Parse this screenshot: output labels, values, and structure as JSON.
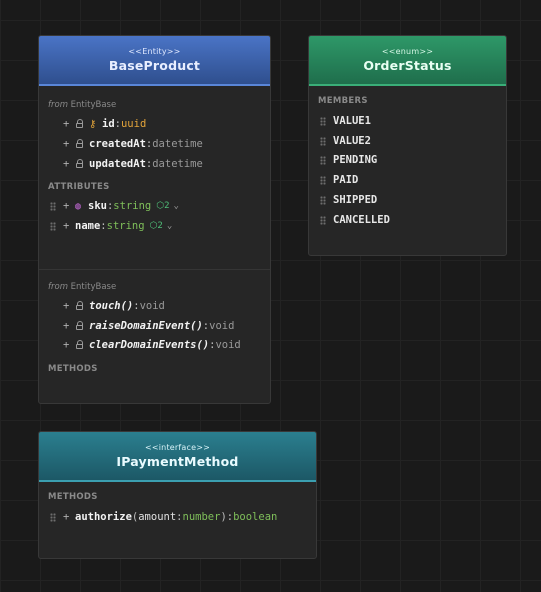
{
  "base_product": {
    "stereotype": "<<Entity>>",
    "name": "BaseProduct",
    "inherited_from_label": "from",
    "inherited_from": "EntityBase",
    "inherited_attributes": [
      {
        "vis": "+",
        "name": "id",
        "type": "uuid",
        "key": true
      },
      {
        "vis": "+",
        "name": "createdAt",
        "type": "datetime"
      },
      {
        "vis": "+",
        "name": "updatedAt",
        "type": "datetime"
      }
    ],
    "attributes_label": "ATTRIBUTES",
    "attributes": [
      {
        "vis": "+",
        "name": "sku",
        "type": "string",
        "badge": "2"
      },
      {
        "vis": "+",
        "name": "name",
        "type": "string",
        "badge": "2"
      }
    ],
    "methods_from_label": "from",
    "methods_from": "EntityBase",
    "inherited_methods": [
      {
        "vis": "+",
        "name": "touch()",
        "type": "void"
      },
      {
        "vis": "+",
        "name": "raiseDomainEvent()",
        "type": "void"
      },
      {
        "vis": "+",
        "name": "clearDomainEvents()",
        "type": "void"
      }
    ],
    "methods_label": "METHODS"
  },
  "order_status": {
    "stereotype": "<<enum>>",
    "name": "OrderStatus",
    "members_label": "MEMBERS",
    "members": [
      "VALUE1",
      "VALUE2",
      "PENDING",
      "PAID",
      "SHIPPED",
      "CANCELLED"
    ]
  },
  "ipayment": {
    "stereotype": "<<interface>>",
    "name": "IPaymentMethod",
    "methods_label": "METHODS",
    "method": {
      "vis": "+",
      "name": "authorize",
      "open": "(",
      "param": "amount",
      "param_type": "number",
      "close": ")",
      "type": "boolean"
    }
  },
  "colors": {
    "entity_header": "#3d63b0",
    "enum_header": "#27845a",
    "interface_header": "#246b7a",
    "key_icon": "#e3a43a",
    "type_green": "#7fbf5a"
  }
}
